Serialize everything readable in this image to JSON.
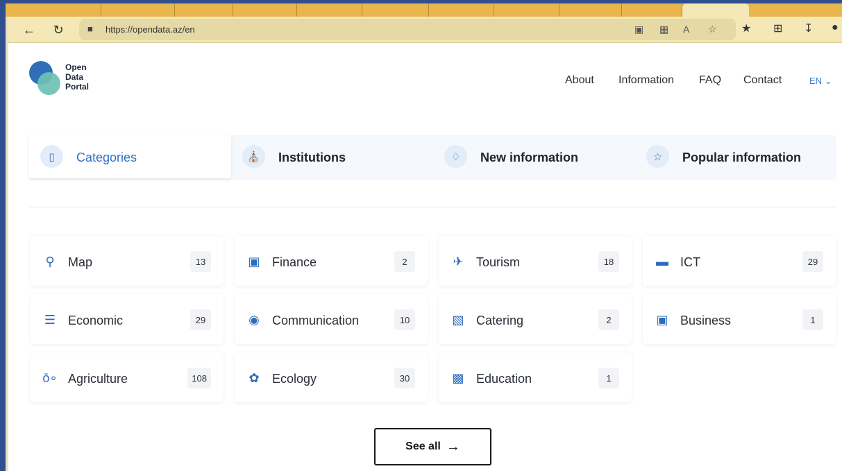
{
  "browser": {
    "url": "https://opendata.az/en"
  },
  "site": {
    "logo_lines": [
      "Open",
      "Data",
      "Portal"
    ],
    "nav": [
      "About",
      "Information",
      "FAQ",
      "Contact"
    ],
    "language": "EN"
  },
  "tabs": [
    {
      "label": "Categories",
      "icon": "book-icon",
      "active": true
    },
    {
      "label": "Institutions",
      "icon": "bank-icon",
      "active": false
    },
    {
      "label": "New information",
      "icon": "bell-icon",
      "active": false
    },
    {
      "label": "Popular information",
      "icon": "star-icon",
      "active": false
    }
  ],
  "categories": [
    {
      "name": "Map",
      "count": "13",
      "icon": "map-pin-icon"
    },
    {
      "name": "Finance",
      "count": "2",
      "icon": "briefcase-icon"
    },
    {
      "name": "Tourism",
      "count": "18",
      "icon": "airplane-icon"
    },
    {
      "name": "ICT",
      "count": "29",
      "icon": "laptop-icon"
    },
    {
      "name": "Economic",
      "count": "29",
      "icon": "coins-icon"
    },
    {
      "name": "Communication",
      "count": "10",
      "icon": "broadcast-icon"
    },
    {
      "name": "Catering",
      "count": "2",
      "icon": "store-icon"
    },
    {
      "name": "Business",
      "count": "1",
      "icon": "briefcase-icon"
    },
    {
      "name": "Agriculture",
      "count": "108",
      "icon": "seeds-icon"
    },
    {
      "name": "Ecology",
      "count": "30",
      "icon": "leaf-icon"
    },
    {
      "name": "Education",
      "count": "1",
      "icon": "book-icon"
    }
  ],
  "see_all": {
    "label": "See all"
  },
  "colors": {
    "accent": "#2f6fc4",
    "logo_blue": "#2f6fb8",
    "logo_teal": "#6dc1b3"
  }
}
